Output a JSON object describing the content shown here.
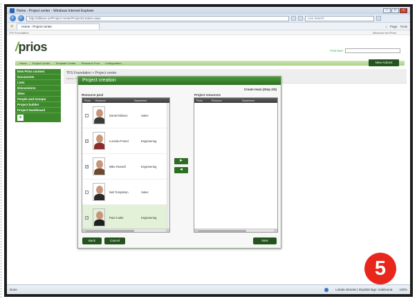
{
  "browser": {
    "window_title": "Home - Project center - Windows Internet Explorer",
    "url": "http://aiflame.se/Project center/ProjectCreation.aspx",
    "search_placeholder": "Live Search",
    "tab_label": "Home - Project center",
    "toolbar_tools": [
      "Page",
      "Tools"
    ],
    "status_left": "Done",
    "status_zone": "Lokala intranät | Skyddat läge: inaktiverat",
    "zoom": "100%"
  },
  "app": {
    "top_label": "TFS Foundation",
    "welcome": "Welcome Nof Prios",
    "logo_text": "prios",
    "find_label": "Find Item",
    "nav_tabs": [
      "Home",
      "Project Center",
      "Template Center",
      "Resource Pool",
      "Configuration"
    ],
    "new_button": "New Actions",
    "sidebar": [
      "New Prios content",
      "Documents",
      "Lists",
      "Discussions",
      "Sites",
      "People and Groups",
      "Project builder",
      "Project Dashboard"
    ],
    "breadcrumb": "TFS Foundation > Project center",
    "subtitle": "Home: Prios Foundation"
  },
  "dialog": {
    "title": "Project creation",
    "create_team_label": "Create team (Step 2/3)",
    "resource_pool_label": "Resource pool",
    "project_resources_label": "Project resources",
    "left_columns": [
      "Photo",
      "Resource",
      "Department"
    ],
    "right_columns": [
      "Photo",
      "Resource",
      "Department"
    ],
    "resources": [
      {
        "name": "Daniel Nilsson",
        "department": "Sales",
        "checked": false,
        "selected": false,
        "shirt": "#3b3b3b"
      },
      {
        "name": "Lucinda Friend",
        "department": "Engineering",
        "checked": true,
        "selected": false,
        "shirt": "#8a2d2a"
      },
      {
        "name": "Mike Russell",
        "department": "Engineering",
        "checked": true,
        "selected": false,
        "shirt": "#6b4a2f"
      },
      {
        "name": "Neil Templeton",
        "department": "Sales",
        "checked": false,
        "selected": false,
        "shirt": "#2a2a2a"
      },
      {
        "name": "Paul Cutler",
        "department": "Engineering",
        "checked": true,
        "selected": true,
        "shirt": "#1f1f1f"
      }
    ],
    "add_arrow": "►",
    "remove_arrow": "◄",
    "back_button": "Back",
    "cancel_button": "Cancel",
    "next_button": "Next"
  },
  "step_badge": "5"
}
